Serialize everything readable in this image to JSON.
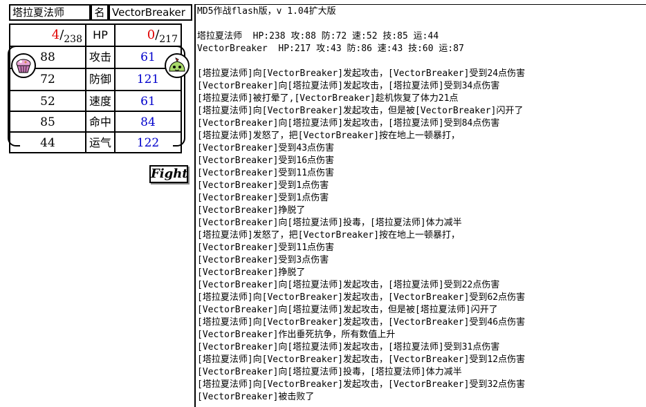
{
  "left_player": {
    "name": "塔拉夏法师",
    "hp_current": "4",
    "hp_max": "238",
    "attack": "88",
    "defense": "72",
    "speed": "52",
    "accuracy": "85",
    "luck": "44"
  },
  "right_player": {
    "name": "VectorBreaker",
    "hp_current": "0",
    "hp_max": "217",
    "attack": "61",
    "defense": "121",
    "speed": "61",
    "accuracy": "84",
    "luck": "122"
  },
  "labels": {
    "name": "名",
    "hp": "HP",
    "attack": "攻击",
    "defense": "防御",
    "speed": "速度",
    "accuracy": "命中",
    "luck": "运气",
    "slash": "/"
  },
  "fight_button": "Fight",
  "log": {
    "lines": [
      "MD5作战flash版，v 1.04扩大版",
      "",
      "塔拉夏法师  HP:238 攻:88 防:72 速:52 技:85 运:44",
      "VectorBreaker  HP:217 攻:43 防:86 速:43 技:60 运:87",
      "",
      "[塔拉夏法师]向[VectorBreaker]发起攻击，[VectorBreaker]受到24点伤害",
      "[VectorBreaker]向[塔拉夏法师]发起攻击，[塔拉夏法师]受到34点伤害",
      "[塔拉夏法师]被打晕了,[VectorBreaker]趁机恢复了体力21点",
      "[塔拉夏法师]向[VectorBreaker]发起攻击，但是被[VectorBreaker]闪开了",
      "[VectorBreaker]向[塔拉夏法师]发起攻击，[塔拉夏法师]受到84点伤害",
      "[塔拉夏法师]发怒了，把[VectorBreaker]按在地上一顿暴打，",
      "[VectorBreaker]受到43点伤害",
      "[VectorBreaker]受到16点伤害",
      "[VectorBreaker]受到11点伤害",
      "[VectorBreaker]受到1点伤害",
      "[VectorBreaker]受到1点伤害",
      "[VectorBreaker]挣脱了",
      "[VectorBreaker]向[塔拉夏法师]投毒，[塔拉夏法师]体力减半",
      "[塔拉夏法师]发怒了，把[VectorBreaker]按在地上一顿暴打，",
      "[VectorBreaker]受到11点伤害",
      "[VectorBreaker]受到3点伤害",
      "[VectorBreaker]挣脱了",
      "[VectorBreaker]向[塔拉夏法师]发起攻击，[塔拉夏法师]受到22点伤害",
      "[塔拉夏法师]向[VectorBreaker]发起攻击，[VectorBreaker]受到62点伤害",
      "[VectorBreaker]向[塔拉夏法师]发起攻击，但是被[塔拉夏法师]闪开了",
      "[塔拉夏法师]向[VectorBreaker]发起攻击，[VectorBreaker]受到46点伤害",
      "[VectorBreaker]作出垂死抗争，所有数值上升",
      "[VectorBreaker]向[塔拉夏法师]发起攻击，[塔拉夏法师]受到31点伤害",
      "[塔拉夏法师]向[VectorBreaker]发起攻击，[VectorBreaker]受到12点伤害",
      "[VectorBreaker]向[塔拉夏法师]投毒，[塔拉夏法师]体力减半",
      "[塔拉夏法师]向[VectorBreaker]发起攻击，[VectorBreaker]受到32点伤害",
      "[VectorBreaker]被击败了"
    ]
  },
  "colors": {
    "hp_current": "#e00000",
    "right_stats": "#0000cc"
  },
  "icons": {
    "left_avatar": "cupcake-icon",
    "right_avatar": "slime-icon"
  }
}
